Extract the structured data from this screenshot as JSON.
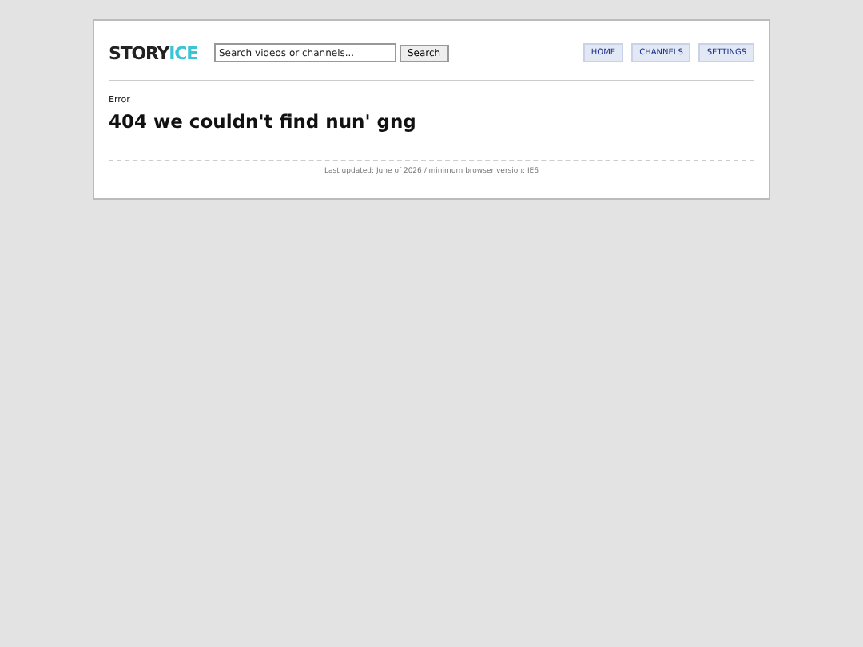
{
  "logo": {
    "part_1": "STORY",
    "part_2": "ICE"
  },
  "search": {
    "placeholder": "Search videos or channels...",
    "button": "Search"
  },
  "nav": [
    "HOME",
    "CHANNELS",
    "SETTINGS"
  ],
  "label": "Error",
  "heading": "404 we couldn't find nun' gng",
  "footer": "Last updated: June of 2026 / minimum browser version: IE6"
}
